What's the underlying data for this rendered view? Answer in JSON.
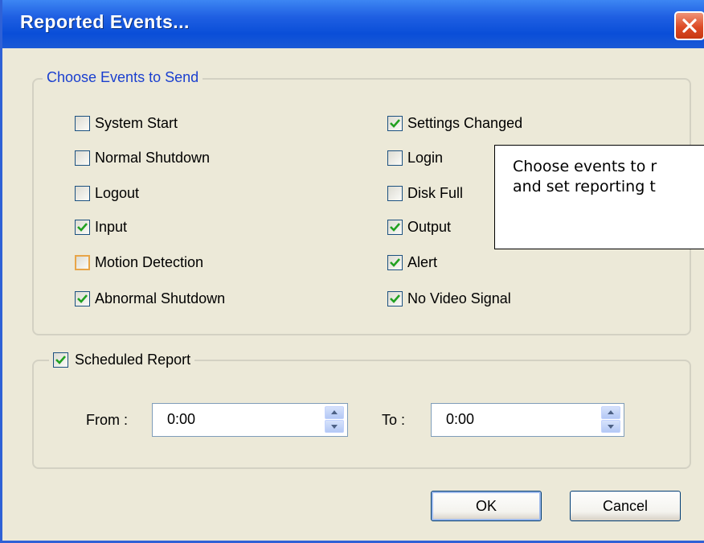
{
  "window": {
    "title": "Reported Events..."
  },
  "events_group": {
    "legend": "Choose Events to Send",
    "left_column": [
      {
        "label": "System Start",
        "checked": false
      },
      {
        "label": "Normal Shutdown",
        "checked": false
      },
      {
        "label": "Logout",
        "checked": false
      },
      {
        "label": "Input",
        "checked": true
      },
      {
        "label": "Motion Detection",
        "checked": false
      },
      {
        "label": "Abnormal Shutdown",
        "checked": true
      }
    ],
    "right_column": [
      {
        "label": "Settings Changed",
        "checked": true
      },
      {
        "label": "Login",
        "checked": false
      },
      {
        "label": "Disk Full",
        "checked": false
      },
      {
        "label": "Output",
        "checked": true
      },
      {
        "label": "Alert",
        "checked": true
      },
      {
        "label": "No Video Signal",
        "checked": true
      }
    ]
  },
  "tooltip": {
    "line1": "Choose events to r",
    "line2": "and set reporting t"
  },
  "scheduled": {
    "label": "Scheduled Report",
    "checked": true,
    "from_label": "From :",
    "from_value": "0:00",
    "to_label": "To :",
    "to_value": "0:00"
  },
  "buttons": {
    "ok": "OK",
    "cancel": "Cancel"
  },
  "colors": {
    "titlebar": "#0a4ed8",
    "close": "#dd4b26",
    "legend": "#1a3fcf",
    "check": "#21a121"
  }
}
